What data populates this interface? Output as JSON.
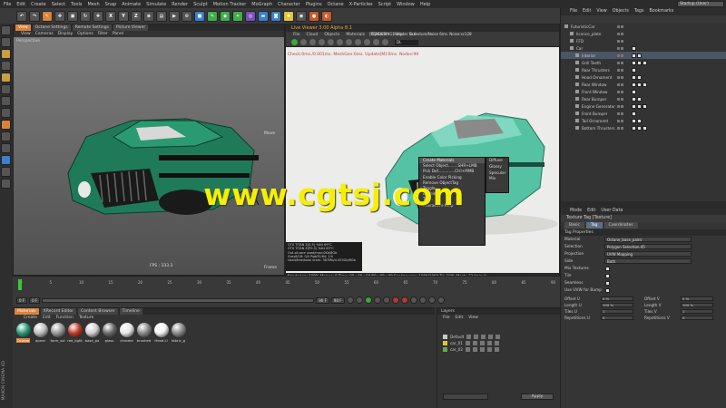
{
  "menubar": {
    "items": [
      "File",
      "Edit",
      "Create",
      "Select",
      "Tools",
      "Mesh",
      "Snap",
      "Animate",
      "Simulate",
      "Render",
      "Sculpt",
      "Motion Tracker",
      "MoGraph",
      "Character",
      "Plugins",
      "Octane",
      "X-Particles",
      "Script",
      "Window",
      "Help"
    ],
    "layout": "Startup (User)"
  },
  "toolbar": {
    "axes": [
      "X",
      "Y",
      "Z"
    ]
  },
  "viewport": {
    "tabs": [
      "View",
      "Octane Settings",
      "Remote Settings",
      "Picture Viewer"
    ],
    "menu": [
      "View",
      "Cameras",
      "Display",
      "Options",
      "Filter",
      "Panel"
    ],
    "label": "Perspective",
    "move": "Move",
    "fps": "FPS : 333.3",
    "frame": "Frame"
  },
  "octane": {
    "title": "Live Viewer 3.00 Alpha 8.1",
    "menu": [
      "File",
      "Cloud",
      "Objects",
      "Materials",
      "Options",
      "Help",
      "Gui"
    ],
    "header_status": "[RENDERING] Shader to texture/Noise  6ms. Noise:sc128",
    "channel": "DL",
    "status_line": "Check:0ms./0.001ms. MeshGen:0ms. Update[M]:0ms. Nodes:99",
    "context_menu": [
      "Create Materials",
      "Select Object........SHR+LMB",
      "Pick Dof..............Ctrl+MMB",
      "Enable Color Picking",
      "Remove ObjectTag",
      "Toggle...",
      "Enable...",
      "Tag...",
      "Interactive Help"
    ],
    "submenu": [
      "Diffuse",
      "Glossy",
      "Specular",
      "Mix"
    ],
    "info_lines": [
      "GTX TITAN Z(0.5)      %84      69°C",
      "GTX TITAN Z(P0.5)     %84      63°C",
      "Out-of-core used/max:0Kb/8Gb",
      "Grey8/16: 0/0       Rgb32/64: 1/0",
      "Used/free/total vram: 367Mb/4.053Gb/6Gb"
    ],
    "render_bar": "Rendering: 100%    Ms/sec: 0    Time: 00 : 00 : 00/00 : 00 : 00    Spp/maxspp: 1000/1000    Tri: 100k    Mesh: 33    Hair: 0",
    "progress": 1.0
  },
  "watermark": "www.cgtsj.com",
  "objects": {
    "menu": [
      "File",
      "Edit",
      "View",
      "Objects",
      "Tags",
      "Bookmarks"
    ],
    "rows": [
      {
        "name": "FuturisticCar",
        "indent": 0
      },
      {
        "name": "licence_plate",
        "indent": 1
      },
      {
        "name": "FFD",
        "indent": 1
      },
      {
        "name": "Car",
        "indent": 1
      },
      {
        "name": "Interior",
        "indent": 2
      },
      {
        "name": "Grill Teeth",
        "indent": 2
      },
      {
        "name": "Rear Thrusters",
        "indent": 2
      },
      {
        "name": "Hood Ornament",
        "indent": 2
      },
      {
        "name": "Rear Window",
        "indent": 2
      },
      {
        "name": "Front Window",
        "indent": 2
      },
      {
        "name": "Rear Bumper",
        "indent": 2
      },
      {
        "name": "Engine Generator",
        "indent": 2
      },
      {
        "name": "Front Bumper",
        "indent": 2
      },
      {
        "name": "Tail Ornament",
        "indent": 2
      },
      {
        "name": "Bottom Thrusters",
        "indent": 2
      }
    ]
  },
  "attributes": {
    "menu": [
      "Mode",
      "Edit",
      "User Data"
    ],
    "title": "Texture Tag [Texture]",
    "tabs": [
      "Basic",
      "Tag",
      "Coordinates"
    ],
    "section": "Tag Properties",
    "props": [
      {
        "label": "Material",
        "value": "Octane_base_paint"
      },
      {
        "label": "Selection",
        "value": "Polygon Selection.45"
      },
      {
        "label": "Projection",
        "value": "UVW Mapping"
      },
      {
        "label": "Side",
        "value": "Both"
      }
    ],
    "checks": [
      "Mix Textures",
      "Tile",
      "Seamless",
      "Use UVW for Bump"
    ],
    "grid": [
      {
        "label": "Offset U",
        "value": "0 %"
      },
      {
        "label": "Offset V",
        "value": "0 %"
      },
      {
        "label": "Length U",
        "value": "100 %"
      },
      {
        "label": "Length V",
        "value": "100 %"
      },
      {
        "label": "Tiles U",
        "value": "1"
      },
      {
        "label": "Tiles V",
        "value": "1"
      },
      {
        "label": "Repetitions U",
        "value": "0"
      },
      {
        "label": "Repetitions V",
        "value": "0"
      }
    ]
  },
  "timeline": {
    "ticks": [
      "0",
      "5",
      "10",
      "15",
      "20",
      "25",
      "30",
      "35",
      "40",
      "45",
      "50",
      "55",
      "60",
      "65",
      "70",
      "75",
      "80",
      "85",
      "90"
    ],
    "frame_start": "0 F",
    "frame_cur": "0 F",
    "frame_end": "90 F",
    "frame_max": "90 F"
  },
  "materials": {
    "tabs": [
      "Materials",
      "XRecord Editor",
      "Content Browser",
      "Timeline"
    ],
    "menu": [
      "Create",
      "Edit",
      "Function",
      "Texture"
    ],
    "balls": [
      {
        "name": "Octane",
        "color": "#2c9a78"
      },
      {
        "name": "apron",
        "color": "#bfbfbf"
      },
      {
        "name": "form_sol",
        "color": "#999999"
      },
      {
        "name": "red_light",
        "color": "#c23a2a"
      },
      {
        "name": "base_pa",
        "color": "#d0d0d0"
      },
      {
        "name": "glass",
        "color": "#6a6a6a"
      },
      {
        "name": "chrome",
        "color": "#e6e6e6"
      },
      {
        "name": "brushed",
        "color": "#8a8a8a"
      },
      {
        "name": "Head.Li",
        "color": "#f2f2f2"
      },
      {
        "name": "fabric_g",
        "color": "#8a8a8a"
      }
    ],
    "brand": "MAXON CINEMA 4D"
  },
  "layers": {
    "title": "Layers",
    "menu": [
      "File",
      "Edit",
      "View"
    ],
    "rows": [
      {
        "name": "Default",
        "color": "#c8c8c8"
      },
      {
        "name": "car_01",
        "color": "#e1c23c"
      },
      {
        "name": "car_02",
        "color": "#5ab04c"
      }
    ],
    "apply": "Apply"
  }
}
